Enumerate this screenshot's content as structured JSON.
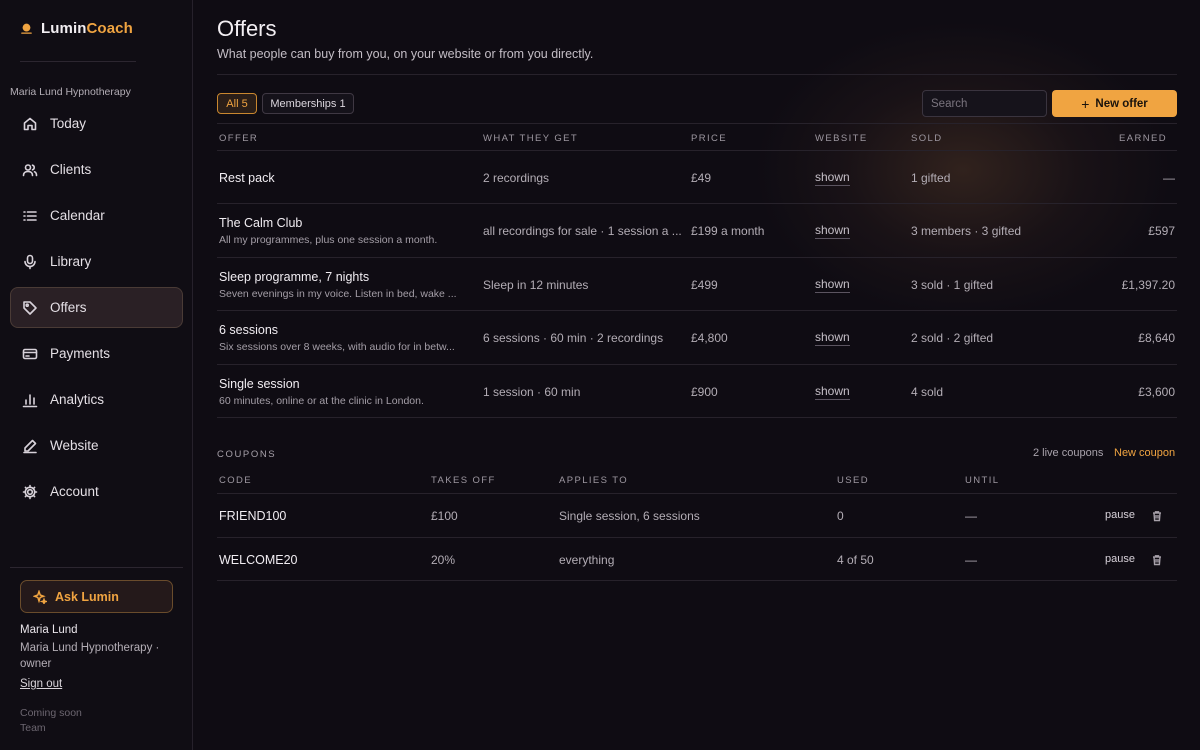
{
  "brand": {
    "part1": "Lumin",
    "part2": "Coach"
  },
  "sidebar": {
    "workspace": "Maria Lund Hypnotherapy",
    "items": [
      {
        "label": "Today",
        "icon": "home-icon"
      },
      {
        "label": "Clients",
        "icon": "users-icon"
      },
      {
        "label": "Calendar",
        "icon": "list-icon"
      },
      {
        "label": "Library",
        "icon": "microphone-icon"
      },
      {
        "label": "Offers",
        "icon": "tag-icon",
        "active": true
      },
      {
        "label": "Payments",
        "icon": "card-icon"
      },
      {
        "label": "Analytics",
        "icon": "bar-chart-icon"
      },
      {
        "label": "Website",
        "icon": "pen-icon"
      },
      {
        "label": "Account",
        "icon": "gear-icon"
      }
    ],
    "ask_label": "Ask Lumin",
    "user_name": "Maria Lund",
    "user_role": "Maria Lund Hypnotherapy · owner",
    "signout": "Sign out",
    "coming_soon": "Coming soon",
    "coming_soon_item": "Team"
  },
  "header": {
    "title": "Offers",
    "subtitle": "What people can buy from you, on your website or from you directly."
  },
  "filters": {
    "all": "All 5",
    "memberships": "Memberships 1"
  },
  "search": {
    "placeholder": "Search"
  },
  "new_offer_label": "New offer",
  "offers_table": {
    "headers": [
      "OFFER",
      "WHAT THEY GET",
      "PRICE",
      "WEBSITE",
      "SOLD",
      "EARNED"
    ],
    "rows": [
      {
        "name": "Rest pack",
        "desc": "",
        "gets": "2 recordings",
        "price": "£49",
        "website": "shown",
        "sold": "1 gifted",
        "earned": "—"
      },
      {
        "name": "The Calm Club",
        "desc": "All my programmes, plus one session a month.",
        "gets": "all recordings for sale · 1 session a ...",
        "price": "£199 a month",
        "website": "shown",
        "sold": "3 members · 3 gifted",
        "earned": "£597"
      },
      {
        "name": "Sleep programme, 7 nights",
        "desc": "Seven evenings in my voice. Listen in bed, wake ...",
        "gets": "Sleep in 12 minutes",
        "price": "£499",
        "website": "shown",
        "sold": "3 sold · 1 gifted",
        "earned": "£1,397.20"
      },
      {
        "name": "6 sessions",
        "desc": "Six sessions over 8 weeks, with audio for in betw...",
        "gets": "6 sessions · 60 min · 2 recordings",
        "price": "£4,800",
        "website": "shown",
        "sold": "2 sold · 2 gifted",
        "earned": "£8,640"
      },
      {
        "name": "Single session",
        "desc": "60 minutes, online or at the clinic in London.",
        "gets": "1 session · 60 min",
        "price": "£900",
        "website": "shown",
        "sold": "4 sold",
        "earned": "£3,600"
      }
    ]
  },
  "coupons": {
    "label": "COUPONS",
    "live": "2 live coupons",
    "new_label": "New coupon",
    "headers": [
      "CODE",
      "TAKES OFF",
      "APPLIES TO",
      "USED",
      "UNTIL"
    ],
    "rows": [
      {
        "code": "FRIEND100",
        "takes_off": "£100",
        "applies_to": "Single session, 6 sessions",
        "used": "0",
        "until": "—",
        "action": "pause"
      },
      {
        "code": "WELCOME20",
        "takes_off": "20%",
        "applies_to": "everything",
        "used": "4 of 50",
        "until": "—",
        "action": "pause"
      }
    ]
  },
  "colors": {
    "accent": "#f0a441",
    "background": "#0f0c13"
  }
}
